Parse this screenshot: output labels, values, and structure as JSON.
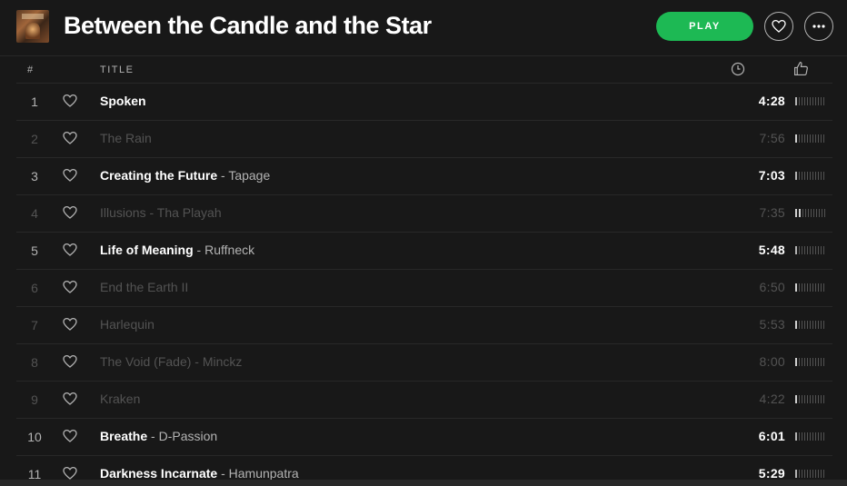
{
  "album": {
    "title": "Between the Candle and the Star"
  },
  "controls": {
    "play_label": "PLAY",
    "play_color": "#1db954"
  },
  "columns": {
    "number": "#",
    "title": "TITLE"
  },
  "icons": {
    "clock": "clock-icon",
    "thumb": "thumbs-up-icon",
    "heart": "heart-icon",
    "more": "more-horizontal-icon"
  },
  "tracks": [
    {
      "num": "1",
      "name": "Spoken",
      "sep": "",
      "artist": "",
      "duration": "4:28",
      "available": true,
      "popularity": 0.1
    },
    {
      "num": "2",
      "name": "The Rain",
      "sep": "",
      "artist": "",
      "duration": "7:56",
      "available": false,
      "popularity": 0.1
    },
    {
      "num": "3",
      "name": "Creating the Future",
      "sep": " - ",
      "artist": "Tapage",
      "duration": "7:03",
      "available": true,
      "popularity": 0.1
    },
    {
      "num": "4",
      "name": "Illusions",
      "sep": " - ",
      "artist": "Tha Playah",
      "duration": "7:35",
      "available": false,
      "popularity": 0.2
    },
    {
      "num": "5",
      "name": "Life of Meaning",
      "sep": " - ",
      "artist": "Ruffneck",
      "duration": "5:48",
      "available": true,
      "popularity": 0.1
    },
    {
      "num": "6",
      "name": "End the Earth II",
      "sep": "",
      "artist": "",
      "duration": "6:50",
      "available": false,
      "popularity": 0.1
    },
    {
      "num": "7",
      "name": "Harlequin",
      "sep": "",
      "artist": "",
      "duration": "5:53",
      "available": false,
      "popularity": 0.1
    },
    {
      "num": "8",
      "name": "The Void (Fade)",
      "sep": " - ",
      "artist": "Minckz",
      "duration": "8:00",
      "available": false,
      "popularity": 0.1
    },
    {
      "num": "9",
      "name": "Kraken",
      "sep": "",
      "artist": "",
      "duration": "4:22",
      "available": false,
      "popularity": 0.1
    },
    {
      "num": "10",
      "name": "Breathe",
      "sep": " - ",
      "artist": "D-Passion",
      "duration": "6:01",
      "available": true,
      "popularity": 0.1
    },
    {
      "num": "11",
      "name": "Darkness Incarnate",
      "sep": " - ",
      "artist": "Hamunpatra",
      "duration": "5:29",
      "available": true,
      "popularity": 0.1
    }
  ]
}
